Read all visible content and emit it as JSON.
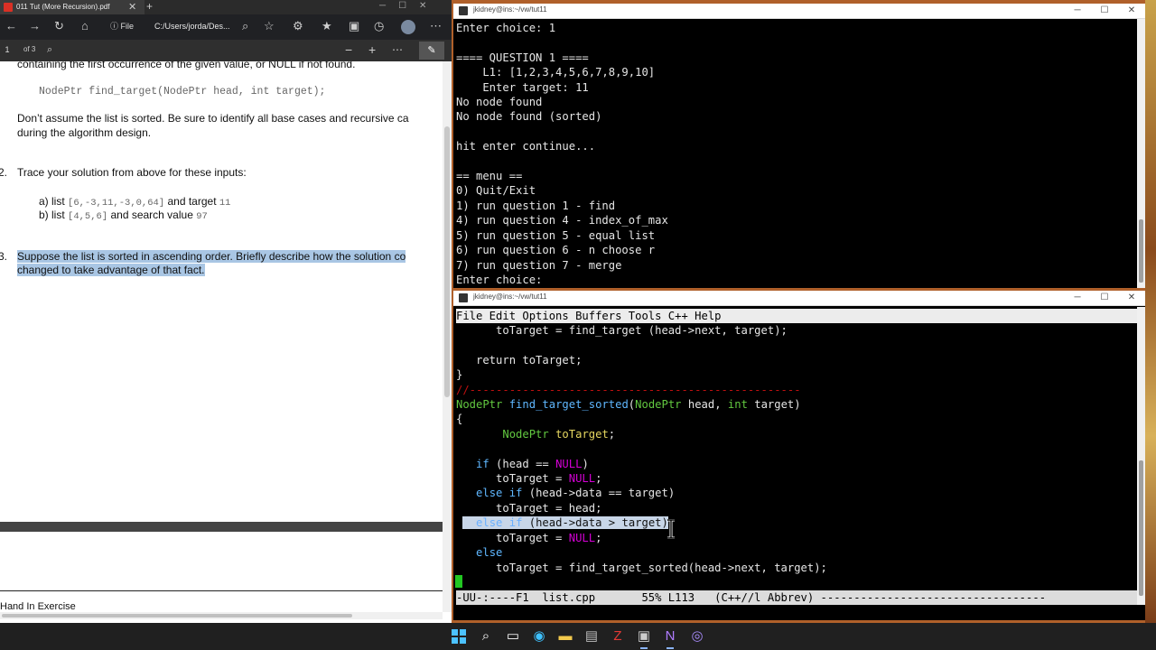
{
  "browser": {
    "tab_title": "011 Tut (More Recursion).pdf",
    "tab_close": "✕",
    "new_tab": "+",
    "info_label": "File",
    "url": "C:/Users/jorda/Des...",
    "page_input": "1",
    "page_of": "of 3"
  },
  "pdf": {
    "line_top": "containing the first occurrence of the given value, or NULL if not found.",
    "signature": "NodePtr find_target(NodePtr head, int target);",
    "assume_1": "Don’t assume the list is sorted.  Be sure to identify all base cases and recursive ca",
    "assume_2": "during the algorithm design.",
    "q2_num": "2.",
    "q2_text": "Trace your solution from above for these inputs:",
    "q2a_label": "a)  list",
    "q2a_code": "[6,-3,11,-3,0,64]",
    "q2a_mid": "and target",
    "q2a_val": "11",
    "q2b_label": "b)  list",
    "q2b_code": "[4,5,6]",
    "q2b_mid": "and search value",
    "q2b_val": "97",
    "q3_num": "3.",
    "q3_line1": "Suppose the list is sorted in ascending order. Briefly describe how the solution co",
    "q3_line2": "changed to take advantage of that fact.",
    "page2_text": "Hand In Exercise"
  },
  "terminal_top": {
    "title": "jkidney@ins:~/vw/tut11",
    "lines": [
      "Enter choice: 1",
      "",
      "==== QUESTION 1 ====",
      "    L1: [1,2,3,4,5,6,7,8,9,10]",
      "    Enter target: 11",
      "No node found",
      "No node found (sorted)",
      "",
      "hit enter continue...",
      "",
      "== menu ==",
      "0) Quit/Exit",
      "1) run question 1 - find",
      "4) run question 4 - index_of_max",
      "5) run question 5 - equal list",
      "6) run question 6 - n choose r",
      "7) run question 7 - merge",
      "Enter choice: "
    ]
  },
  "terminal_bottom": {
    "title": "jkidney@ins:~/vw/tut11",
    "menu": "File Edit Options Buffers Tools C++ Help",
    "code": {
      "l1": "      toTarget = find_target (head->next, target);",
      "l3": "   return toTarget;",
      "l4": "}",
      "l5": "//--------------------------------------------------",
      "l6_type": "NodePtr",
      "l6_fn": "find_target_sorted",
      "l6_p1t": "NodePtr",
      "l6_p1": " head, ",
      "l6_p2t": "int",
      "l6_p2": " target)",
      "l7": "{",
      "l8_type": "NodePtr",
      "l8_var": "toTarget",
      "l8_end": ";",
      "l10_kw": "if",
      "l10_a": " (head == ",
      "l10_null": "NULL",
      "l10_b": ")",
      "l11_a": "      toTarget = ",
      "l11_null": "NULL",
      "l11_b": ";",
      "l12_kw": "else if",
      "l12_rest": " (head->data == target)",
      "l13": "      toTarget = head;",
      "l14_kw1": "else",
      "l14_kw2": "if",
      "l14_rest": " (head->data > target)",
      "l15_a": "      toTarget = ",
      "l15_null": "NULL",
      "l15_b": ";",
      "l16_kw": "else",
      "l17": "      toTarget = find_target_sorted(head->next, target);"
    },
    "modeline": "-UU-:----F1  list.cpp       55% L113   (C++//l Abbrev) ----------------------------------"
  },
  "window_controls": {
    "minimize": "─",
    "maximize": "☐",
    "close": "✕"
  },
  "taskbar": {
    "icons": [
      "windows-start-icon",
      "search-icon",
      "file-explorer-icon",
      "edge-icon",
      "folder-icon",
      "app-icon",
      "filezilla-icon",
      "terminal-icon",
      "onenote-icon",
      "obs-icon"
    ]
  }
}
